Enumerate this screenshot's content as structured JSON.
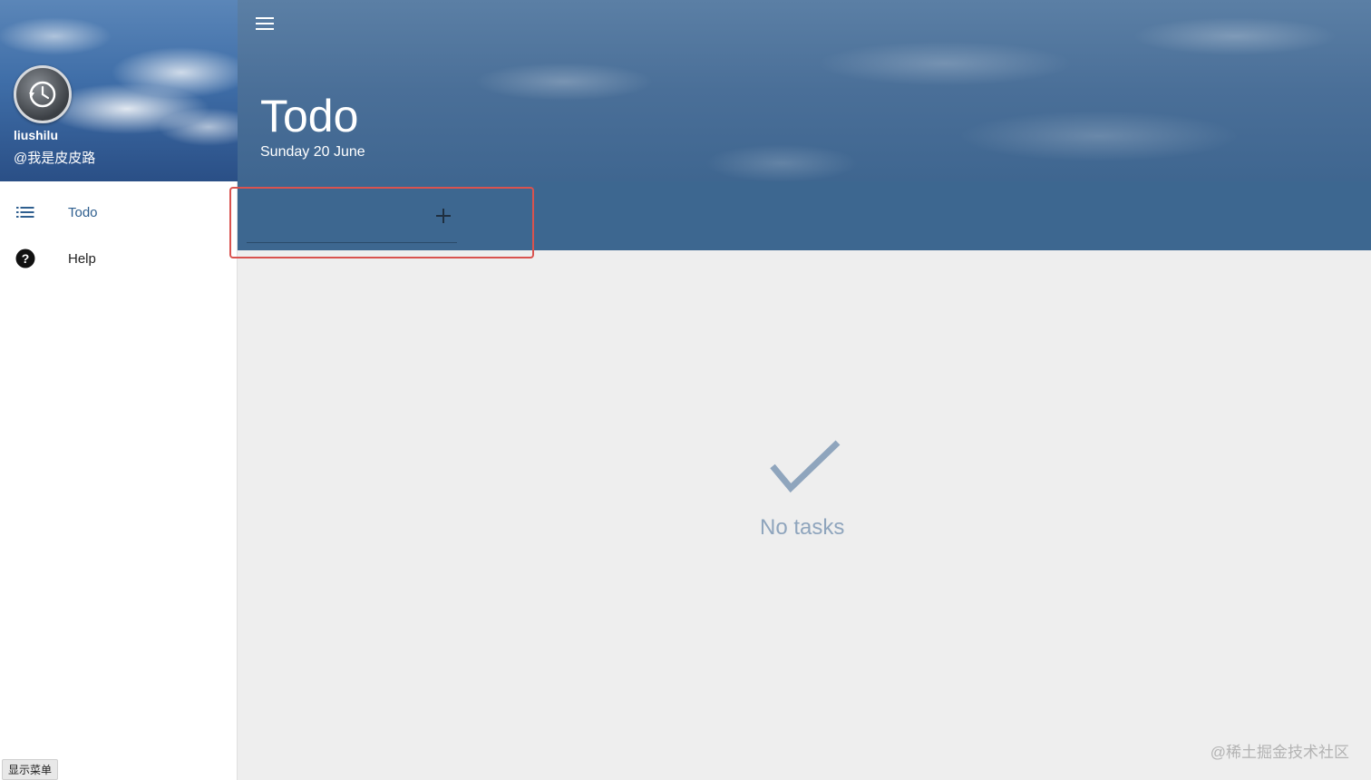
{
  "sidebar": {
    "user_name": "liushilu",
    "user_handle": "@我是皮皮路",
    "items": [
      {
        "label": "Todo",
        "icon": "list-icon"
      },
      {
        "label": "Help",
        "icon": "help-circle-icon"
      }
    ],
    "menu_badge": "显示菜单"
  },
  "header": {
    "title": "Todo",
    "date": "Sunday 20 June"
  },
  "add_task": {
    "placeholder": "",
    "button_icon": "plus-icon"
  },
  "empty_state": {
    "icon": "checkmark-icon",
    "text": "No tasks"
  },
  "watermark": "@稀土掘金技术社区",
  "colors": {
    "primary": "#3d6790",
    "header": "#4a6f98",
    "nav_active": "#2f5f8f",
    "empty_text": "#8fa5bd",
    "highlight": "#d9534f"
  }
}
